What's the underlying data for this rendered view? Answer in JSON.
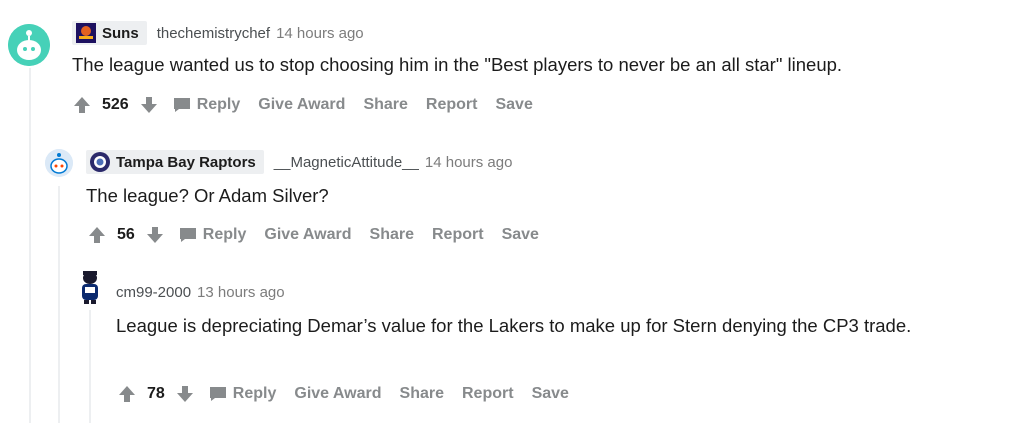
{
  "comments": [
    {
      "flair": "Suns",
      "flair_icon": "suns-logo-icon",
      "username": "thechemistrychef",
      "time": "14 hours ago",
      "body": "The league wanted us to stop choosing him in the \"Best players to never be an all star\" lineup.",
      "score": "526",
      "actions": {
        "reply": "Reply",
        "award": "Give Award",
        "share": "Share",
        "report": "Report",
        "save": "Save"
      }
    },
    {
      "flair": "Tampa Bay Raptors",
      "flair_icon": "raptors-logo-icon",
      "username": "__MagneticAttitude__",
      "time": "14 hours ago",
      "body": "The league? Or Adam Silver?",
      "score": "56",
      "actions": {
        "reply": "Reply",
        "award": "Give Award",
        "share": "Share",
        "report": "Report",
        "save": "Save"
      }
    },
    {
      "username": "cm99-2000",
      "time": "13 hours ago",
      "body": "League is depreciating Demar’s value for the Lakers to make up for Stern denying the CP3 trade.",
      "score": "78",
      "actions": {
        "reply": "Reply",
        "award": "Give Award",
        "share": "Share",
        "report": "Report",
        "save": "Save"
      }
    }
  ],
  "colors": {
    "avatar_teal": "#46d1b8",
    "avatar_blue": "#0dd3bb",
    "thread_line": "#edeff1",
    "muted": "#878a8c"
  }
}
